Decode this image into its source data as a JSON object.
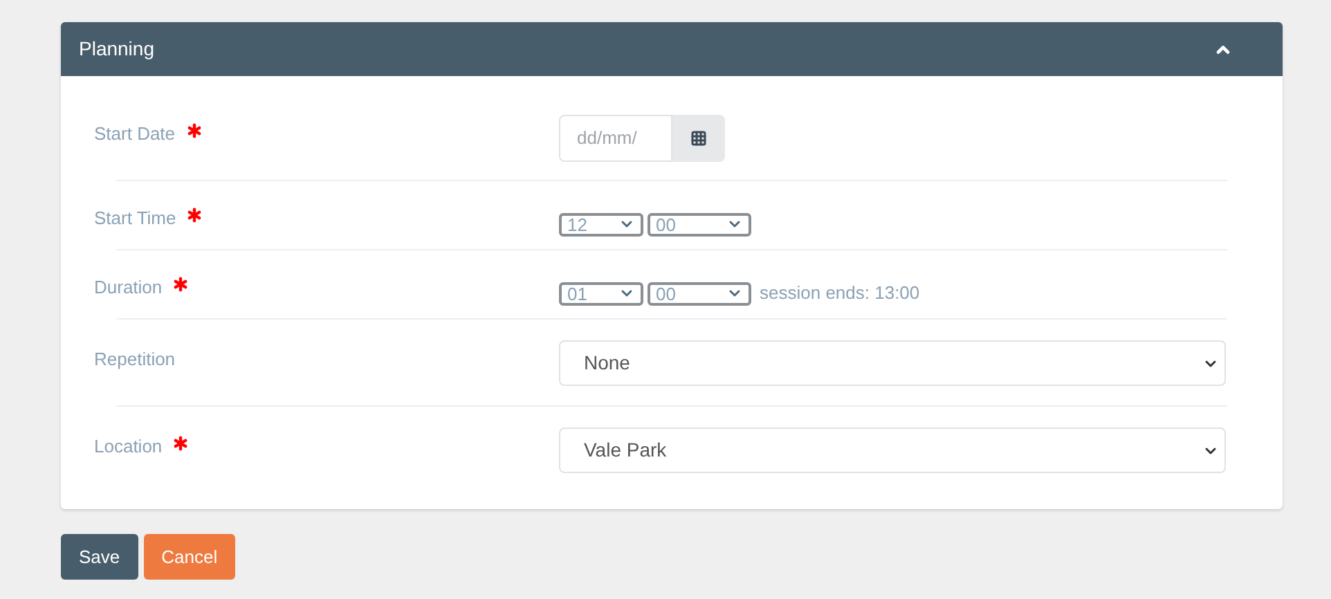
{
  "panel": {
    "title": "Planning",
    "expanded": true
  },
  "rows": [
    {
      "label": "Start Date",
      "required": true,
      "kind": "date",
      "placeholder": "dd/mm/"
    },
    {
      "label": "Start Time",
      "required": true,
      "kind": "time",
      "hour": "12",
      "minute": "00"
    },
    {
      "label": "Duration",
      "required": true,
      "kind": "time",
      "hour": "01",
      "minute": "00",
      "note": "session ends: 13:00"
    },
    {
      "label": "Repetition",
      "required": false,
      "kind": "select",
      "value": "None"
    },
    {
      "label": "Location",
      "required": true,
      "kind": "select",
      "value": "Vale Park"
    }
  ],
  "buttons": [
    {
      "label": "Save",
      "kind": "primary"
    },
    {
      "label": "Cancel",
      "kind": "danger"
    }
  ]
}
